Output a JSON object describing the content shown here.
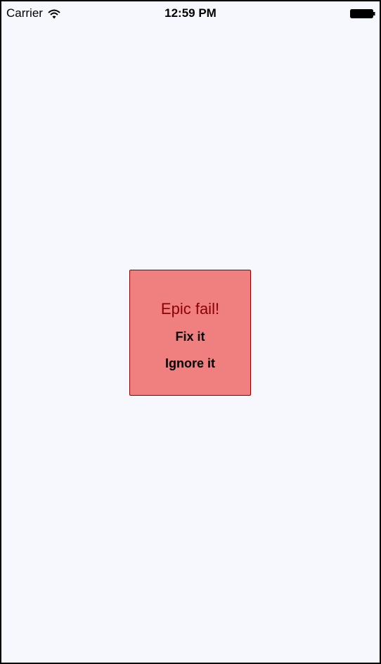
{
  "status_bar": {
    "carrier": "Carrier",
    "time": "12:59 PM",
    "wifi_icon": "wifi-icon",
    "battery_icon": "battery-icon"
  },
  "alert": {
    "title": "Epic fail!",
    "fix_label": "Fix it",
    "ignore_label": "Ignore it",
    "colors": {
      "background": "#f08080",
      "border": "#8b0000",
      "title": "#8b0000",
      "button_text": "#000000"
    }
  },
  "screen": {
    "background": "#f7f8fd"
  }
}
